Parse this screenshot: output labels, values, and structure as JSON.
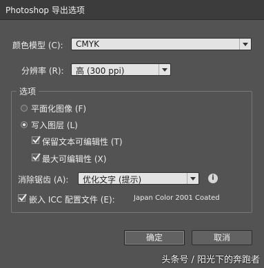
{
  "window": {
    "title": "Photoshop 导出选项"
  },
  "color_model": {
    "label": "颜色模型 (C):",
    "value": "CMYK"
  },
  "resolution": {
    "label": "分辨率 (R):",
    "value": "高 (300 ppi)"
  },
  "options": {
    "legend": "选项",
    "flatten": {
      "label": "平面化图像 (F)",
      "selected": false
    },
    "write_layers": {
      "label": "写入图层 (L)",
      "selected": true
    },
    "keep_text_editable": {
      "label": "保留文本可编辑性 (T)",
      "checked": true
    },
    "max_editability": {
      "label": "最大可编辑性 (X)",
      "checked": true
    }
  },
  "antialias": {
    "label": "消除锯齿 (A):",
    "value": "优化文字 (提示)",
    "info_icon": "info-icon"
  },
  "embed_icc": {
    "label": "嵌入 ICC 配置文件 (E):",
    "profile": "Japan Color 2001 Coated",
    "checked": true
  },
  "buttons": {
    "ok": "确定",
    "cancel": "取消"
  },
  "watermark": "头条号 / 阳光下的奔跑者"
}
